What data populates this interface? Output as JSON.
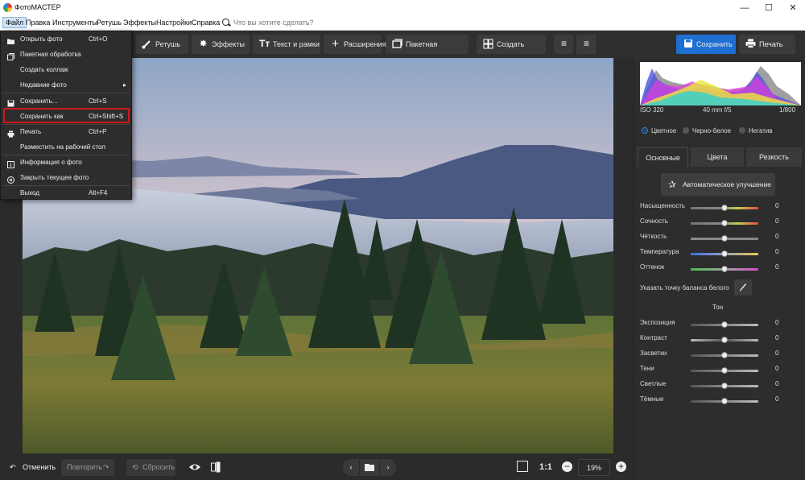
{
  "window": {
    "title": "ФотоМАСТЕР",
    "minimize": "—",
    "maximize": "☐",
    "close": "✕"
  },
  "menubar": {
    "items": [
      "Файл",
      "Правка",
      "Инструменты",
      "Ретушь",
      "Эффекты",
      "Настройки",
      "Справка"
    ],
    "search_placeholder": "Что вы хотите сделать?"
  },
  "toolbar": {
    "retouch": "Ретушь",
    "effects": "Эффекты",
    "text_frames": "Текст и рамки",
    "extensions": "Расширения",
    "batch": "Пакетная обработка",
    "collage": "Создать коллаж",
    "save": "Сохранить",
    "print": "Печать"
  },
  "file_menu": {
    "items": [
      {
        "label": "Открыть фото",
        "shortcut": "Ctrl+O",
        "icon": "folder-icon"
      },
      {
        "label": "Пакетная обработка",
        "shortcut": "",
        "icon": "batch-icon"
      },
      {
        "label": "Создать коллаж",
        "shortcut": "",
        "icon": "collage-icon"
      },
      {
        "label": "Недавние фото",
        "shortcut": "",
        "icon": "",
        "submenu": "▸"
      },
      {
        "label": "Сохранить...",
        "shortcut": "Ctrl+S",
        "icon": "save-icon"
      },
      {
        "label": "Сохранить как",
        "shortcut": "Ctrl+Shift+S",
        "icon": "",
        "highlighted": true
      },
      {
        "label": "Печать",
        "shortcut": "Ctrl+P",
        "icon": "print-icon"
      },
      {
        "label": "Разместить на рабочий стол",
        "shortcut": "",
        "icon": ""
      },
      {
        "label": "Информация о фото",
        "shortcut": "",
        "icon": "info-icon"
      },
      {
        "label": "Закрыть текущее фото",
        "shortcut": "",
        "icon": "close-circle-icon"
      },
      {
        "label": "Выход",
        "shortcut": "Alt+F4",
        "icon": ""
      }
    ]
  },
  "bottombar": {
    "undo": "Отменить",
    "redo": "Повторить",
    "reset": "Сбросить",
    "ratio": "1:1",
    "zoom": "19%"
  },
  "panel": {
    "iso": "ISO 320",
    "lens": "40 mm f/5",
    "shutter": "1/800",
    "modes": [
      "Цветное",
      "Черно-белое",
      "Негатив"
    ],
    "tabs": [
      "Основные",
      "Цвета",
      "Резкость"
    ],
    "auto_enhance": "Автоматическое улучшение",
    "sliders": [
      {
        "label": "Насыщенность",
        "value": "0"
      },
      {
        "label": "Сочность",
        "value": "0"
      },
      {
        "label": "Чёткость",
        "value": "0"
      },
      {
        "label": "Температура",
        "value": "0"
      },
      {
        "label": "Оттенок",
        "value": "0"
      }
    ],
    "white_balance": "Указать точку баланса белого",
    "tone_title": "Тон",
    "tone_sliders": [
      {
        "label": "Экспозиция",
        "value": "0"
      },
      {
        "label": "Контраст",
        "value": "0"
      },
      {
        "label": "Засветки",
        "value": "0"
      },
      {
        "label": "Тени",
        "value": "0"
      },
      {
        "label": "Светлые",
        "value": "0"
      },
      {
        "label": "Тёмные",
        "value": "0"
      }
    ]
  },
  "colors": {
    "accent": "#1f6fd2",
    "highlight_border": "#d0191c"
  }
}
